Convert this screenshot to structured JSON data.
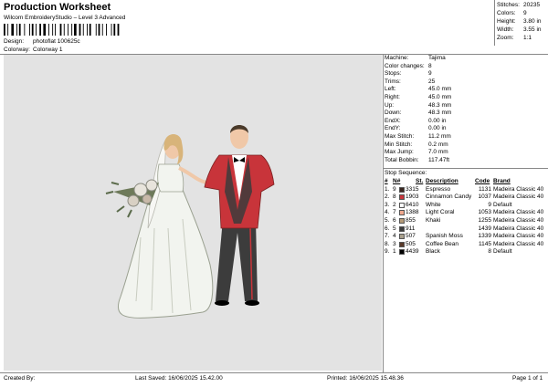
{
  "header": {
    "title": "Production Worksheet",
    "subtitle": "Wilcom EmbroideryStudio – Level 3 Advanced"
  },
  "meta": {
    "design_label": "Design:",
    "design_value": "photoflat 100625c",
    "colorway_label": "Colorway:",
    "colorway_value": "Colorway 1"
  },
  "stats": [
    {
      "label": "Stitches:",
      "value": "20235"
    },
    {
      "label": "Colors:",
      "value": "9"
    },
    {
      "label": "Height:",
      "value": "3.80 in"
    },
    {
      "label": "Width:",
      "value": "3.55 in"
    },
    {
      "label": "Zoom:",
      "value": "1:1"
    }
  ],
  "machine_info": [
    {
      "label": "Machine:",
      "value": "Tajima"
    },
    {
      "label": "Color changes:",
      "value": "8"
    },
    {
      "label": "Stops:",
      "value": "9"
    },
    {
      "label": "Trims:",
      "value": "25"
    },
    {
      "label": "Left:",
      "value": "45.0 mm"
    },
    {
      "label": "Right:",
      "value": "45.0 mm"
    },
    {
      "label": "Up:",
      "value": "48.3 mm"
    },
    {
      "label": "Down:",
      "value": "48.3 mm"
    },
    {
      "label": "EndX:",
      "value": "0.00 in"
    },
    {
      "label": "EndY:",
      "value": "0.00 in"
    },
    {
      "label": "Max Stitch:",
      "value": "11.2 mm"
    },
    {
      "label": "Min Stitch:",
      "value": "0.2 mm"
    },
    {
      "label": "Max Jump:",
      "value": "7.0 mm"
    },
    {
      "label": "Total Bobbin:",
      "value": "117.47ft"
    }
  ],
  "stop_sequence": {
    "title": "Stop Sequence:",
    "headers": [
      "#",
      "N#",
      "St.",
      "Description",
      "Code",
      "Brand"
    ],
    "rows": [
      {
        "num": "1.",
        "n": "9",
        "color": "#3a2620",
        "st": "3315",
        "desc": "Espresso",
        "code": "1131",
        "brand": "Madeira Classic 40"
      },
      {
        "num": "2.",
        "n": "8",
        "color": "#c8343a",
        "st": "1903",
        "desc": "Cinnamon Candy",
        "code": "1037",
        "brand": "Madeira Classic 40"
      },
      {
        "num": "3.",
        "n": "2",
        "color": "#ffffff",
        "st": "6410",
        "desc": "White",
        "code": "9",
        "brand": "Default"
      },
      {
        "num": "4.",
        "n": "7",
        "color": "#f0a88e",
        "st": "1388",
        "desc": "Light Coral",
        "code": "1053",
        "brand": "Madeira Classic 40"
      },
      {
        "num": "5.",
        "n": "6",
        "color": "#b49a78",
        "st": "855",
        "desc": "Khaki",
        "code": "1255",
        "brand": "Madeira Classic 40"
      },
      {
        "num": "6.",
        "n": "5",
        "color": "#3c3c3c",
        "st": "911",
        "desc": "",
        "code": "1439",
        "brand": "Madeira Classic 40"
      },
      {
        "num": "7.",
        "n": "4",
        "color": "#a9a08d",
        "st": "507",
        "desc": "Spanish Moss",
        "code": "1339",
        "brand": "Madeira Classic 40"
      },
      {
        "num": "8.",
        "n": "3",
        "color": "#5a3a2a",
        "st": "505",
        "desc": "Coffee Bean",
        "code": "1145",
        "brand": "Madeira Classic 40"
      },
      {
        "num": "9.",
        "n": "1",
        "color": "#000000",
        "st": "4439",
        "desc": "Black",
        "code": "8",
        "brand": "Default"
      }
    ]
  },
  "footer": {
    "created_by": "Created By:",
    "last_saved": "Last Saved: 16/06/2025 15.42.00",
    "printed": "Printed: 16/06/2025 15.48.36",
    "page": "Page 1 of 1"
  },
  "colors": {
    "canvas_bg": "#e3e3e3",
    "suit_red": "#c8343a",
    "suit_dark": "#3c3c3c",
    "dress": "#f2f4ef",
    "skin": "#f0c8a8"
  }
}
